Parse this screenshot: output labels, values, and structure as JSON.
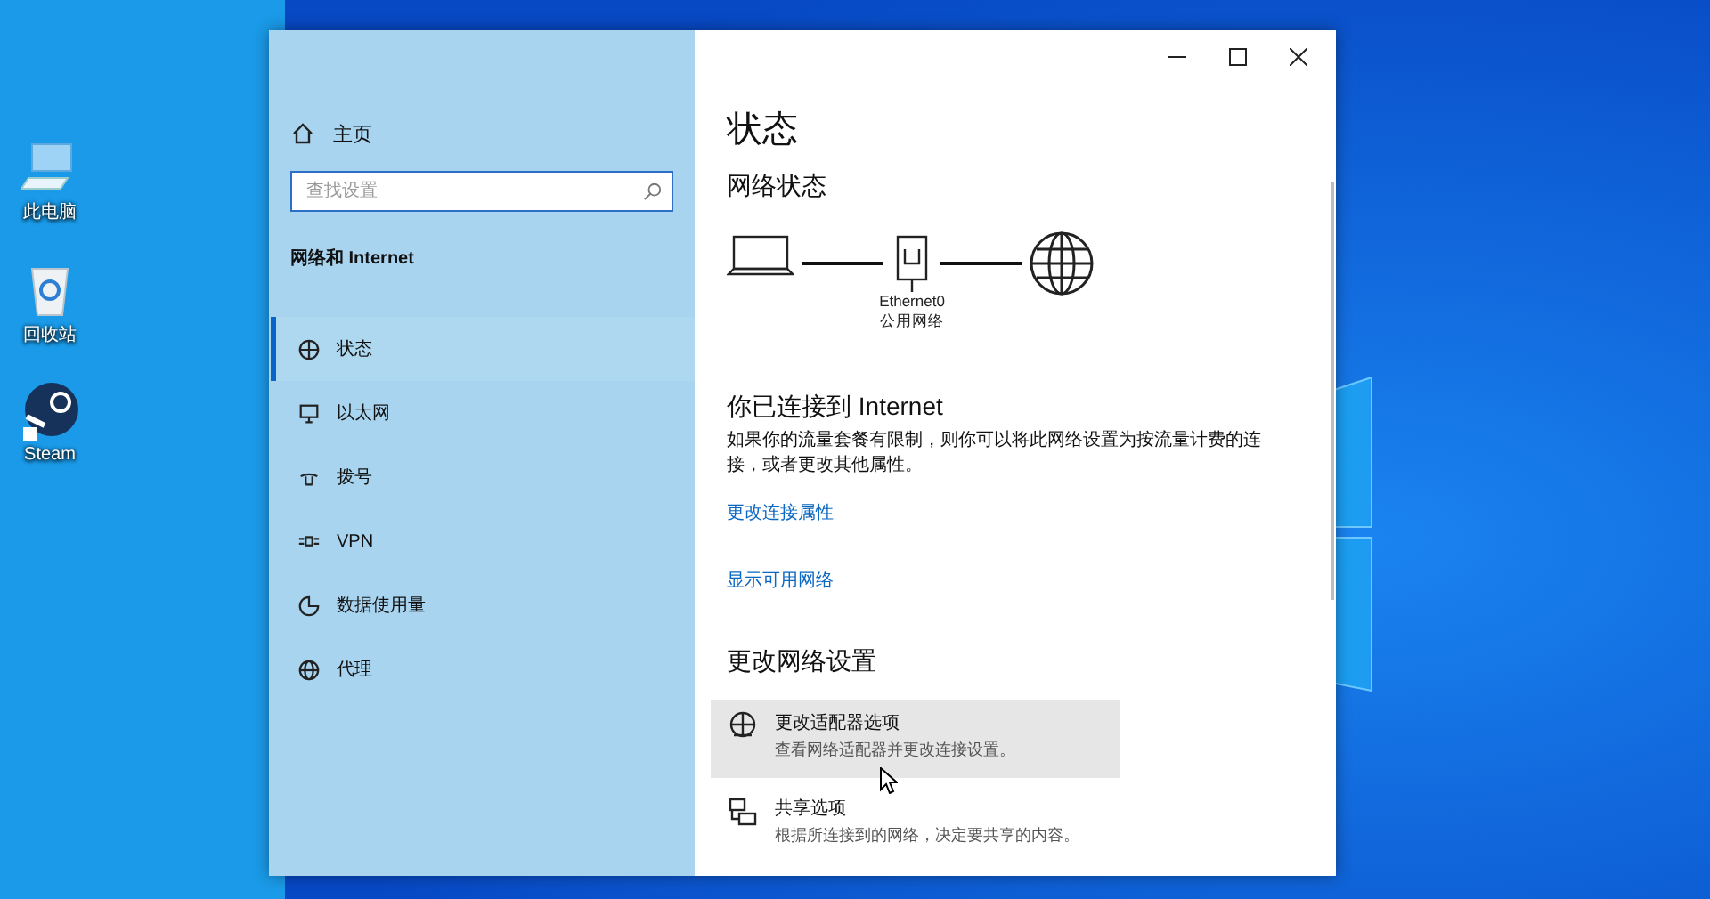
{
  "desktop_icons": [
    {
      "label": "此电脑",
      "kind": "computer"
    },
    {
      "label": "回收站",
      "kind": "recycle"
    },
    {
      "label": "Steam",
      "kind": "steam"
    }
  ],
  "sidebar": {
    "home": "主页",
    "search": {
      "placeholder": "查找设置"
    },
    "section": "网络和 Internet",
    "items": [
      {
        "label": "状态",
        "kind": "status",
        "selected": true
      },
      {
        "label": "以太网",
        "kind": "ethernet",
        "selected": false
      },
      {
        "label": "拨号",
        "kind": "dialup",
        "selected": false
      },
      {
        "label": "VPN",
        "kind": "vpn",
        "selected": false
      },
      {
        "label": "数据使用量",
        "kind": "data",
        "selected": false
      },
      {
        "label": "代理",
        "kind": "proxy",
        "selected": false
      }
    ]
  },
  "main": {
    "title": "状态",
    "network_status": {
      "heading": "网络状态",
      "adapter_name": "Ethernet0",
      "network_type": "公用网络"
    },
    "connected": {
      "heading": "你已连接到 Internet",
      "description": "如果你的流量套餐有限制，则你可以将此网络设置为按流量计费的连接，或者更改其他属性。",
      "links": [
        "更改连接属性",
        "显示可用网络"
      ]
    },
    "change_settings": {
      "heading": "更改网络设置",
      "options": [
        {
          "kind": "adapter",
          "title": "更改适配器选项",
          "description": "查看网络适配器并更改连接设置。",
          "hovered": true
        },
        {
          "kind": "sharing",
          "title": "共享选项",
          "description": "根据所连接到的网络，决定要共享的内容。",
          "hovered": false
        }
      ]
    }
  }
}
